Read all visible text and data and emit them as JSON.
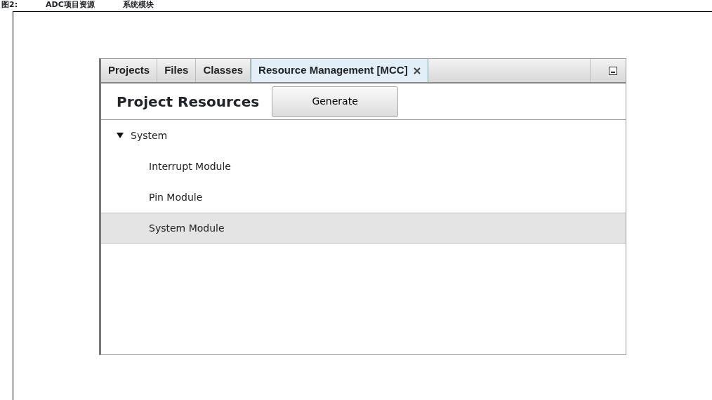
{
  "caption": {
    "number": "图2:",
    "title": "ADC项目资源",
    "subtitle": "系统模块"
  },
  "tabs": [
    {
      "label": "Projects",
      "selected": false
    },
    {
      "label": "Files",
      "selected": false
    },
    {
      "label": "Classes",
      "selected": false
    },
    {
      "label": "Resource Management [MCC]",
      "selected": true
    }
  ],
  "header": {
    "title": "Project Resources",
    "button": "Generate"
  },
  "tree": [
    {
      "label": "System",
      "expanded": true,
      "selected": false,
      "children": [
        {
          "label": "Interrupt Module",
          "selected": false
        },
        {
          "label": "Pin Module",
          "selected": false
        },
        {
          "label": "System Module",
          "selected": true
        }
      ]
    }
  ]
}
